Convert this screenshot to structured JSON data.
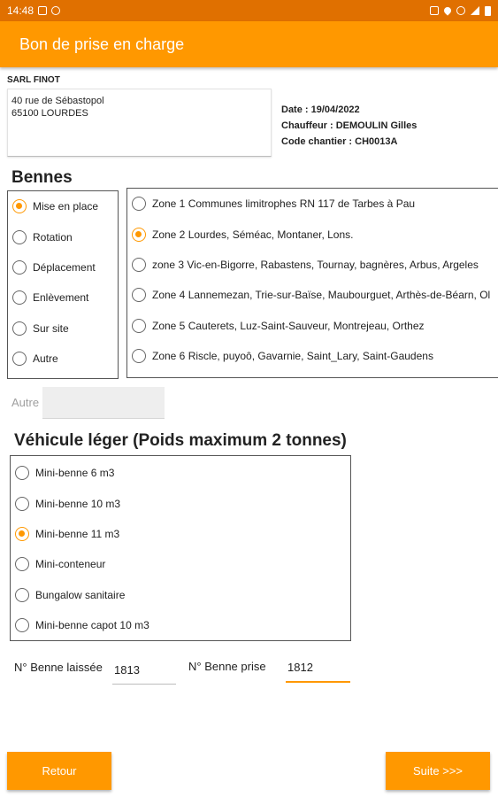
{
  "status_bar": {
    "time": "14:48",
    "icons": [
      "image-icon",
      "whatsapp-icon",
      "mute-icon",
      "location-icon",
      "wifi-icon",
      "signal-icon",
      "battery-icon"
    ]
  },
  "app": {
    "title": "Bon de prise en charge",
    "accent_color": "#ff9800",
    "status_bar_color": "#e07000"
  },
  "client": {
    "name": "SARL FINOT",
    "address_line1": "40 rue de Sébastopol",
    "address_line2": "65100 LOURDES"
  },
  "meta": {
    "date": "Date : 19/04/2022",
    "chauffeur": "Chauffeur : DEMOULIN Gilles",
    "chantier": "Code chantier : CH0013A"
  },
  "bennes": {
    "heading": "Bennes",
    "types": [
      {
        "label": "Mise en place",
        "checked": true
      },
      {
        "label": "Rotation",
        "checked": false
      },
      {
        "label": "Déplacement",
        "checked": false
      },
      {
        "label": "Enlèvement",
        "checked": false
      },
      {
        "label": "Sur site",
        "checked": false
      },
      {
        "label": "Autre",
        "checked": false
      }
    ],
    "zones": [
      {
        "label": "Zone 1 Communes limitrophes RN 117 de Tarbes à Pau",
        "checked": false
      },
      {
        "label": "Zone 2 Lourdes, Séméac, Montaner, Lons.",
        "checked": true
      },
      {
        "label": "zone 3 Vic-en-Bigorre, Rabastens, Tournay, bagnères, Arbus, Argeles",
        "checked": false
      },
      {
        "label": "Zone 4 Lannemezan, Trie-sur-Baïse, Maubourguet, Arthès-de-Béarn, Ol",
        "checked": false
      },
      {
        "label": "Zone 5 Cauterets, Luz-Saint-Sauveur, Montrejeau, Orthez",
        "checked": false
      },
      {
        "label": "Zone 6 Riscle, puyoô, Gavarnie, Saint_Lary, Saint-Gaudens",
        "checked": false
      }
    ],
    "autre_label": "Autre",
    "autre_value": ""
  },
  "vehicule": {
    "heading": "Véhicule léger (Poids maximum 2 tonnes)",
    "options": [
      {
        "label": "Mini-benne 6 m3",
        "checked": false
      },
      {
        "label": "Mini-benne 10 m3",
        "checked": false
      },
      {
        "label": "Mini-benne 11 m3",
        "checked": true
      },
      {
        "label": "Mini-conteneur",
        "checked": false
      },
      {
        "label": "Bungalow sanitaire",
        "checked": false
      },
      {
        "label": "Mini-benne capot 10 m3",
        "checked": false
      }
    ]
  },
  "numeros": {
    "laissee_label": "N° Benne laissée",
    "laissee_value": "1813",
    "prise_label": "N° Benne prise",
    "prise_value": "1812"
  },
  "buttons": {
    "retour": "Retour",
    "suite": "Suite >>>"
  }
}
